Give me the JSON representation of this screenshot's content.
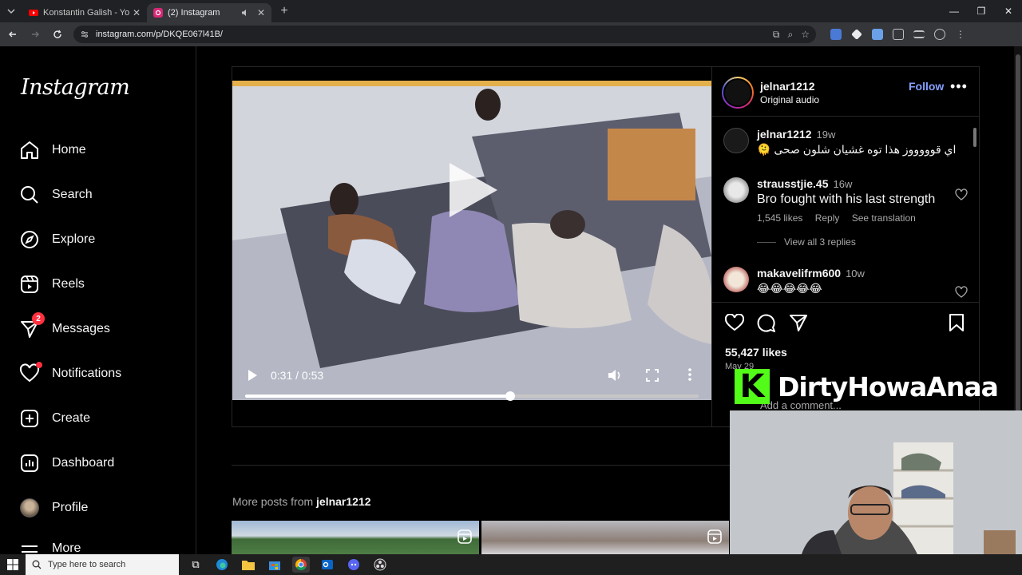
{
  "browser": {
    "tabs": [
      {
        "title": "Konstantin Galish - YouTube",
        "favicon": "youtube-icon",
        "active": false
      },
      {
        "title": "(2) Instagram",
        "favicon": "instagram-icon",
        "active": true
      }
    ],
    "url": "instagram.com/p/DKQE067l41B/"
  },
  "sidebar": {
    "logo": "Instagram",
    "items": [
      {
        "label": "Home",
        "icon": "home-icon"
      },
      {
        "label": "Search",
        "icon": "search-icon"
      },
      {
        "label": "Explore",
        "icon": "compass-icon"
      },
      {
        "label": "Reels",
        "icon": "reels-icon"
      },
      {
        "label": "Messages",
        "icon": "messenger-icon",
        "badge": "2"
      },
      {
        "label": "Notifications",
        "icon": "heart-icon"
      },
      {
        "label": "Create",
        "icon": "plus-square-icon"
      },
      {
        "label": "Dashboard",
        "icon": "dashboard-icon"
      },
      {
        "label": "Profile",
        "icon": "avatar"
      },
      {
        "label": "More",
        "icon": "menu-icon"
      }
    ]
  },
  "video": {
    "time": "0:31 / 0:53",
    "progress": 0.585
  },
  "post": {
    "username": "jelnar1212",
    "audio": "Original audio",
    "follow": "Follow",
    "likes": "55,427 likes",
    "date": "May 29",
    "add_comment": "Add a comment..."
  },
  "comments": [
    {
      "user": "jelnar1212",
      "time": "19w",
      "text": "اي قوووووز هذا توه غشيان شلون صحى 🫠"
    },
    {
      "user": "strausstjie.45",
      "time": "16w",
      "text": "Bro fought with his last strength",
      "likes": "1,545 likes",
      "reply": "Reply",
      "translate": "See translation",
      "view_replies": "View all 3 replies"
    },
    {
      "user": "makavelifrm600",
      "time": "10w",
      "text": "😂😂😂😂😂"
    }
  ],
  "more_posts": {
    "prefix": "More posts from ",
    "user": "jelnar1212"
  },
  "overlay": {
    "streamer": "DirtyHowaAnaa",
    "kick_letter": "K",
    "brand_color": "#53fc18"
  },
  "taskbar": {
    "search_placeholder": "Type here to search"
  },
  "colors": {
    "link": "#85a1ff",
    "badge": "#ff3040",
    "progress_track": "#c7c7c7"
  }
}
